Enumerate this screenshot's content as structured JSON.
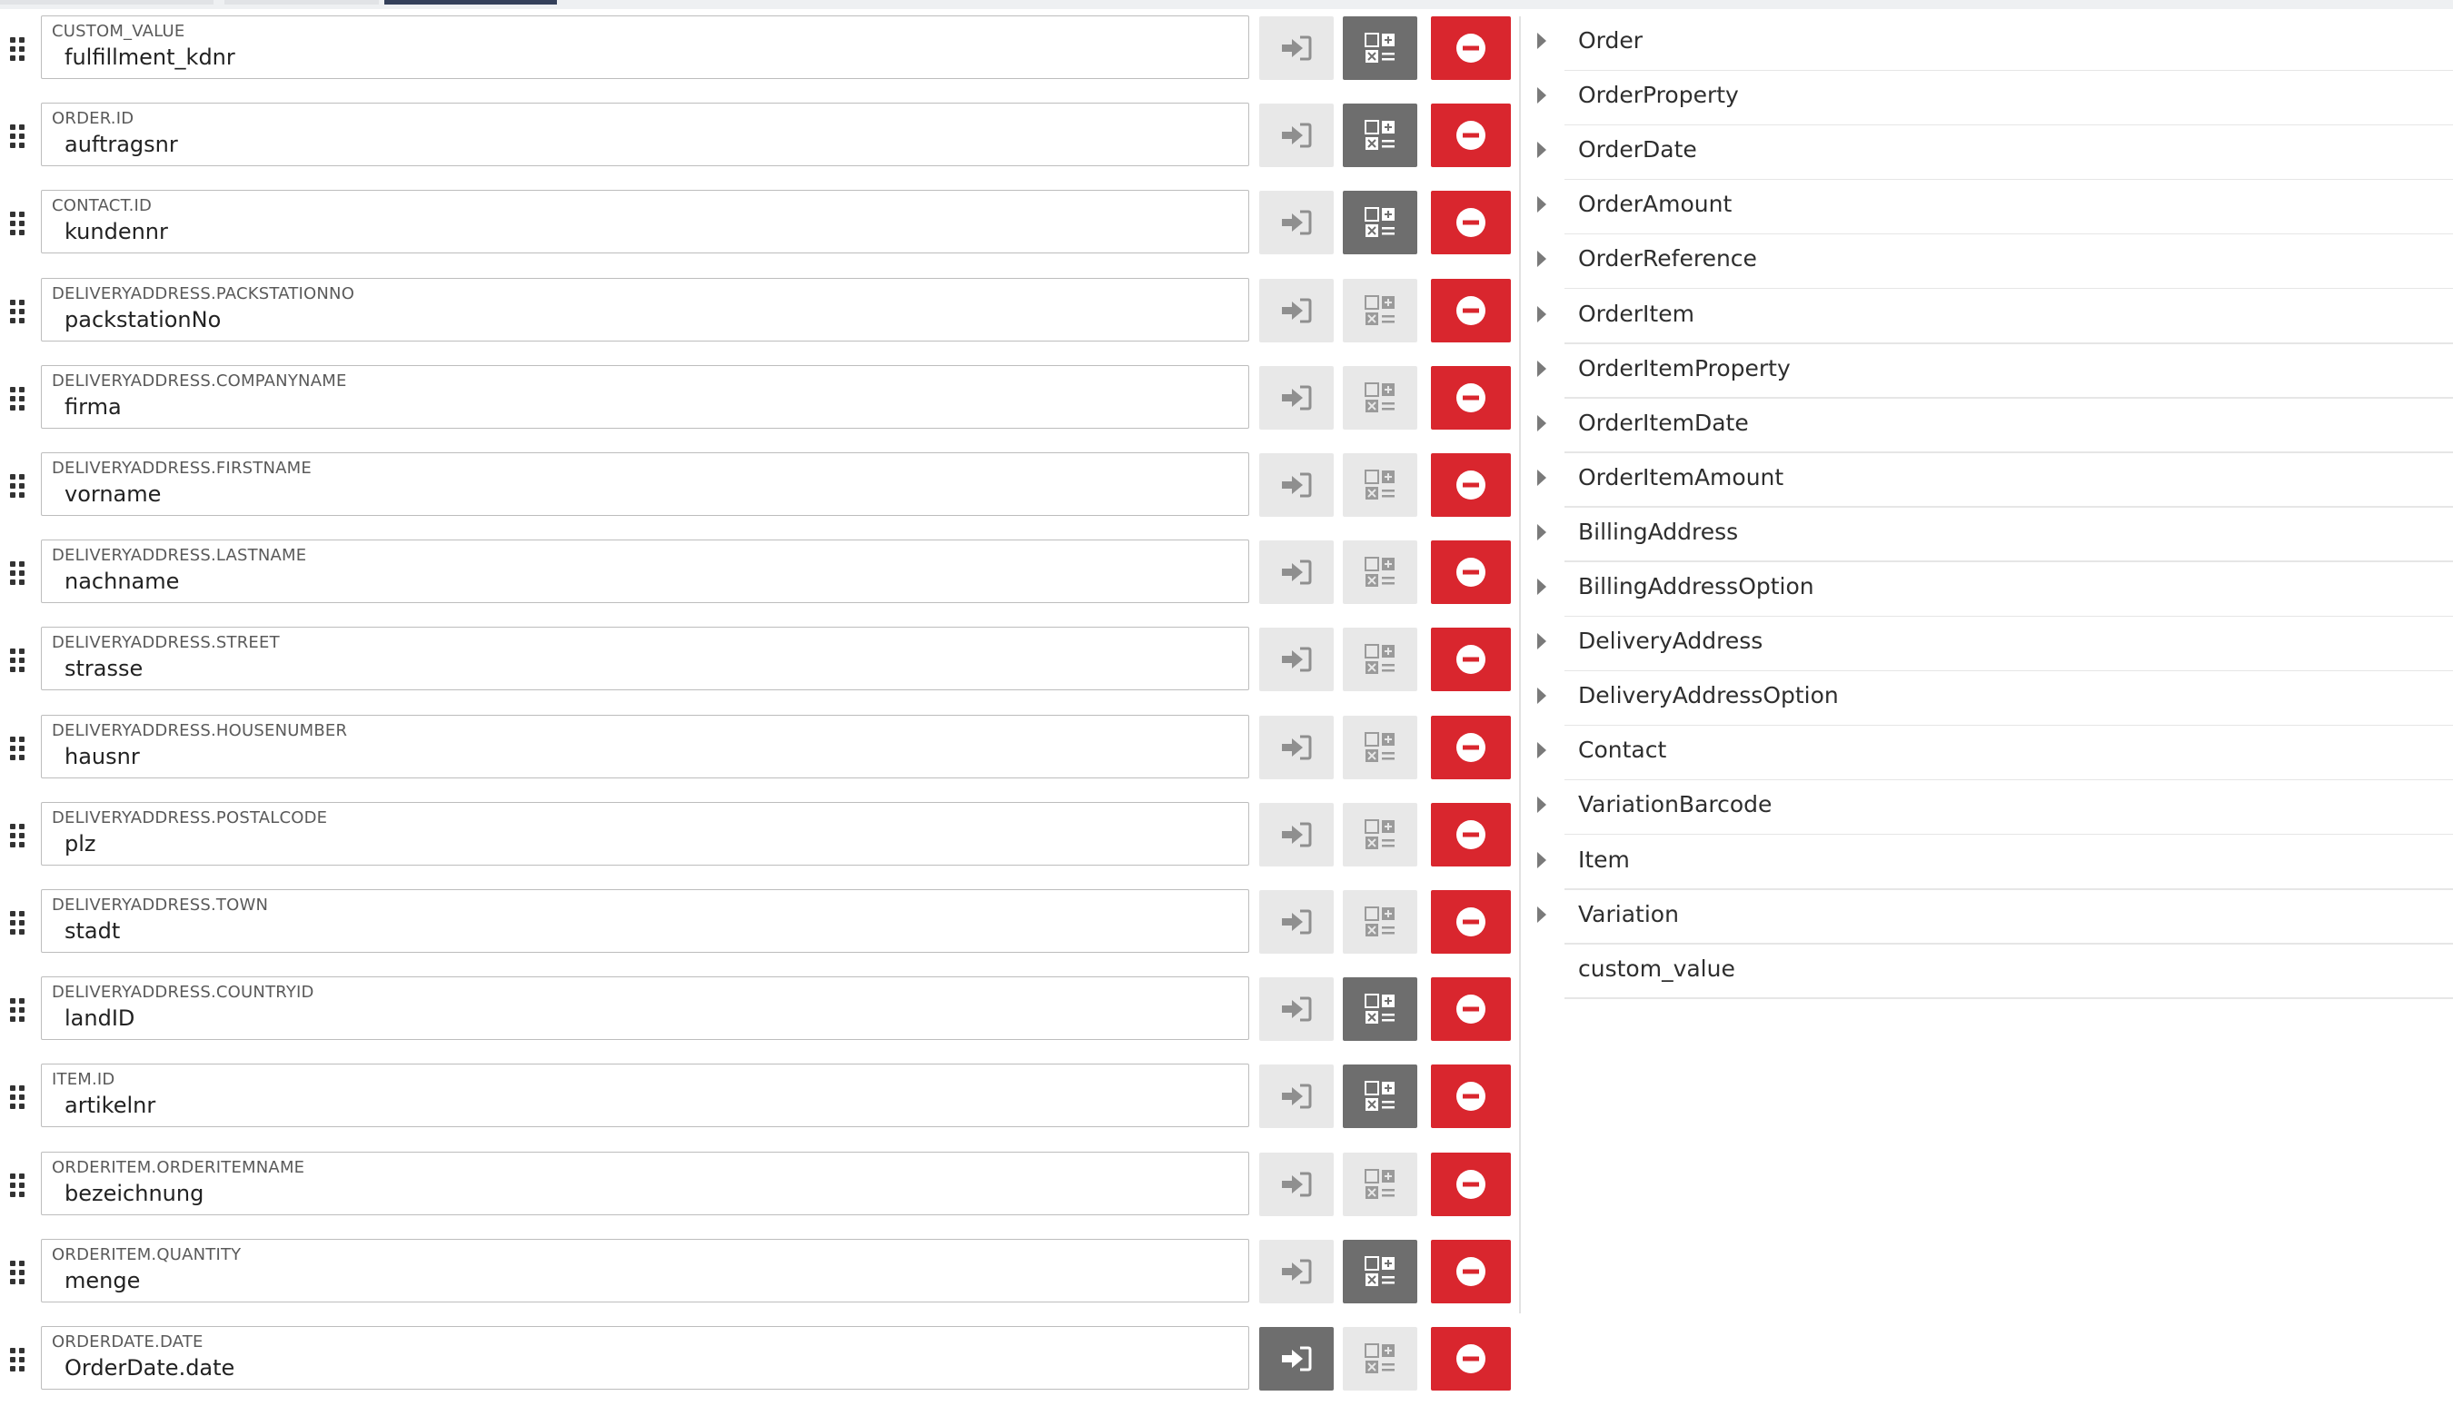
{
  "tabs": [
    "",
    "",
    ""
  ],
  "mappings": [
    {
      "label": "CUSTOM_VALUE",
      "value": "fulfillment_kdnr",
      "insert_active": false,
      "calc_active": true
    },
    {
      "label": "ORDER.ID",
      "value": "auftragsnr",
      "insert_active": false,
      "calc_active": true
    },
    {
      "label": "CONTACT.ID",
      "value": "kundennr",
      "insert_active": false,
      "calc_active": true
    },
    {
      "label": "DELIVERYADDRESS.PACKSTATIONNO",
      "value": "packstationNo",
      "insert_active": false,
      "calc_active": false
    },
    {
      "label": "DELIVERYADDRESS.COMPANYNAME",
      "value": "firma",
      "insert_active": false,
      "calc_active": false
    },
    {
      "label": "DELIVERYADDRESS.FIRSTNAME",
      "value": "vorname",
      "insert_active": false,
      "calc_active": false
    },
    {
      "label": "DELIVERYADDRESS.LASTNAME",
      "value": "nachname",
      "insert_active": false,
      "calc_active": false
    },
    {
      "label": "DELIVERYADDRESS.STREET",
      "value": "strasse",
      "insert_active": false,
      "calc_active": false
    },
    {
      "label": "DELIVERYADDRESS.HOUSENUMBER",
      "value": "hausnr",
      "insert_active": false,
      "calc_active": false
    },
    {
      "label": "DELIVERYADDRESS.POSTALCODE",
      "value": "plz",
      "insert_active": false,
      "calc_active": false
    },
    {
      "label": "DELIVERYADDRESS.TOWN",
      "value": "stadt",
      "insert_active": false,
      "calc_active": false
    },
    {
      "label": "DELIVERYADDRESS.COUNTRYID",
      "value": "landID",
      "insert_active": false,
      "calc_active": true
    },
    {
      "label": "ITEM.ID",
      "value": "artikelnr",
      "insert_active": false,
      "calc_active": true
    },
    {
      "label": "ORDERITEM.ORDERITEMNAME",
      "value": "bezeichnung",
      "insert_active": false,
      "calc_active": false
    },
    {
      "label": "ORDERITEM.QUANTITY",
      "value": "menge",
      "insert_active": false,
      "calc_active": true
    },
    {
      "label": "ORDERDATE.DATE",
      "value": "OrderDate.date",
      "insert_active": true,
      "calc_active": false
    }
  ],
  "icons": {
    "drag": "drag-handle-icon",
    "insert": "sign-in-arrow-icon",
    "calc": "calculator-icon",
    "remove": "minus-circle-icon",
    "expand": "caret-right-icon"
  },
  "colors": {
    "remove_button": "#d9262e",
    "active_button": "#6e6e6e",
    "inactive_button": "#e8e8e8",
    "active_tab": "#34405a"
  },
  "tree": [
    {
      "label": "Order",
      "expandable": true
    },
    {
      "label": "OrderProperty",
      "expandable": true
    },
    {
      "label": "OrderDate",
      "expandable": true
    },
    {
      "label": "OrderAmount",
      "expandable": true
    },
    {
      "label": "OrderReference",
      "expandable": true
    },
    {
      "label": "OrderItem",
      "expandable": true
    },
    {
      "label": "OrderItemProperty",
      "expandable": true
    },
    {
      "label": "OrderItemDate",
      "expandable": true
    },
    {
      "label": "OrderItemAmount",
      "expandable": true
    },
    {
      "label": "BillingAddress",
      "expandable": true
    },
    {
      "label": "BillingAddressOption",
      "expandable": true
    },
    {
      "label": "DeliveryAddress",
      "expandable": true
    },
    {
      "label": "DeliveryAddressOption",
      "expandable": true
    },
    {
      "label": "Contact",
      "expandable": true
    },
    {
      "label": "VariationBarcode",
      "expandable": true
    },
    {
      "label": "Item",
      "expandable": true
    },
    {
      "label": "Variation",
      "expandable": true
    },
    {
      "label": "custom_value",
      "expandable": false
    }
  ]
}
